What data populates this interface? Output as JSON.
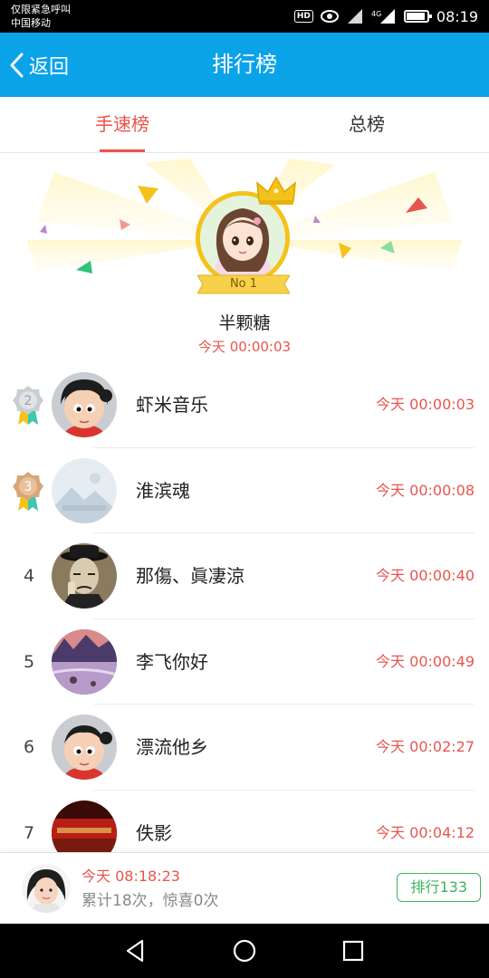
{
  "status_bar": {
    "line1": "仅限紧急呼叫",
    "line2": "中国移动",
    "hd": "HD",
    "time": "08:19",
    "icons": [
      "hd-icon",
      "eye-icon",
      "signal-icon",
      "4g-signal-icon",
      "battery-icon"
    ]
  },
  "header": {
    "back_label": "返回",
    "title": "排行榜",
    "background": "#0aa3e8"
  },
  "tabs": [
    {
      "label": "手速榜",
      "active": true
    },
    {
      "label": "总榜",
      "active": false
    }
  ],
  "top_winner": {
    "badge": "No 1",
    "name": "半颗糖",
    "time": "今天 00:00:03"
  },
  "rankings": [
    {
      "rank": "2",
      "medal": "silver",
      "name": "虾米音乐",
      "time": "今天 00:00:03"
    },
    {
      "rank": "3",
      "medal": "bronze",
      "name": "淮滨魂",
      "time": "今天 00:00:08"
    },
    {
      "rank": "4",
      "name": "那傷、眞凄涼",
      "time": "今天 00:00:40"
    },
    {
      "rank": "5",
      "name": "李飞你好",
      "time": "今天 00:00:49"
    },
    {
      "rank": "6",
      "name": "漂流他乡",
      "time": "今天 00:02:27"
    },
    {
      "rank": "7",
      "name": "佚影",
      "time": "今天 00:04:12"
    }
  ],
  "my_rank": {
    "time": "今天 08:18:23",
    "stats": "累计18次，惊喜0次",
    "button_label": "排行133"
  },
  "colors": {
    "accent_red": "#e8554e",
    "accent_green": "#3cb35a",
    "gold": "#f4c21c"
  }
}
